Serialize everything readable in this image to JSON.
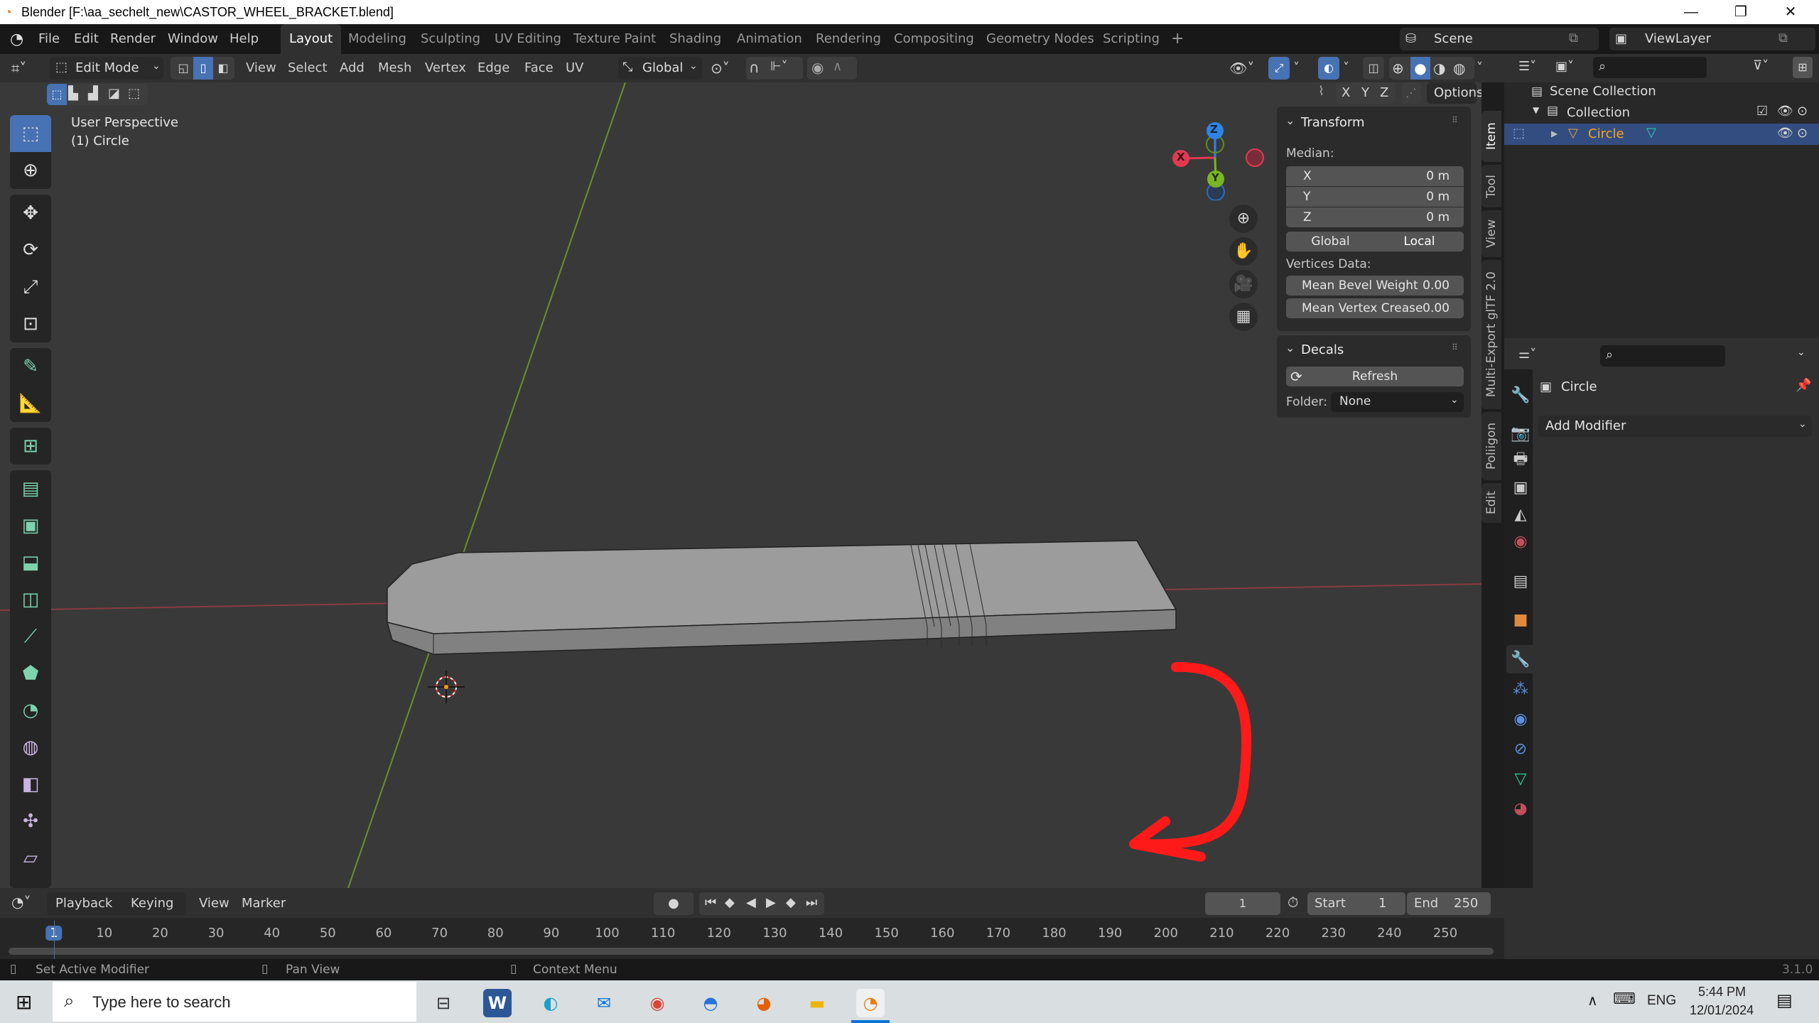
{
  "window": {
    "title": "Blender [F:\\aa_sechelt_new\\CASTOR_WHEEL_BRACKET.blend]",
    "controls": {
      "minimize": "—",
      "restore": "❐",
      "close": "✕"
    }
  },
  "menu": [
    "File",
    "Edit",
    "Render",
    "Window",
    "Help"
  ],
  "workspaces": [
    {
      "label": "Layout",
      "active": true
    },
    {
      "label": "Modeling"
    },
    {
      "label": "Sculpting"
    },
    {
      "label": "UV Editing"
    },
    {
      "label": "Texture Paint"
    },
    {
      "label": "Shading"
    },
    {
      "label": "Animation"
    },
    {
      "label": "Rendering"
    },
    {
      "label": "Compositing"
    },
    {
      "label": "Geometry Nodes"
    },
    {
      "label": "Scripting"
    }
  ],
  "add_workspace": "+",
  "scene": {
    "label": "Scene",
    "view_layer": "ViewLayer"
  },
  "header3d": {
    "mode": "Edit Mode",
    "menus": [
      "View",
      "Select",
      "Add",
      "Mesh",
      "Vertex",
      "Edge",
      "Face",
      "UV"
    ],
    "orientation": "Global",
    "mirror_axes": [
      "X",
      "Y",
      "Z"
    ],
    "options": "Options"
  },
  "viewport": {
    "perspective": "User Perspective",
    "object_label": "(1) Circle",
    "gizmo": {
      "x": "X",
      "y": "Y",
      "z": "Z"
    },
    "annotation_color": "#ff1a1a"
  },
  "transform_panel": {
    "title": "Transform",
    "median_label": "Median:",
    "fields": [
      {
        "axis": "X",
        "value": "0 m"
      },
      {
        "axis": "Y",
        "value": "0 m"
      },
      {
        "axis": "Z",
        "value": "0 m"
      }
    ],
    "space_options": [
      "Global",
      "Local"
    ],
    "active_space": "Local",
    "vertices_label": "Vertices Data:",
    "bevel_weight_label": "Mean Bevel Weight",
    "bevel_weight_value": "0.00",
    "vertex_crease_label": "Mean Vertex Crease",
    "vertex_crease_value": "0.00"
  },
  "decals_panel": {
    "title": "Decals",
    "refresh": "Refresh",
    "folder_label": "Folder:",
    "folder_value": "None"
  },
  "sidebar_tabs": [
    "Item",
    "Tool",
    "View",
    "Multi-Export glTF 2.0",
    "Poliigon",
    "Edit"
  ],
  "outliner": {
    "root": "Scene Collection",
    "collection": "Collection",
    "object": "Circle"
  },
  "properties": {
    "object_name": "Circle",
    "add_modifier": "Add Modifier"
  },
  "timeline": {
    "menus": [
      "Playback",
      "Keying",
      "View",
      "Marker"
    ],
    "current_frame": "1",
    "start_label": "Start",
    "start_value": "1",
    "end_label": "End",
    "end_value": "250",
    "ticks": [
      "1",
      "10",
      "20",
      "30",
      "40",
      "50",
      "60",
      "70",
      "80",
      "90",
      "100",
      "110",
      "120",
      "130",
      "140",
      "150",
      "160",
      "170",
      "180",
      "190",
      "200",
      "210",
      "220",
      "230",
      "240",
      "250"
    ]
  },
  "statusbar": {
    "left": "Set Active Modifier",
    "middle": "Pan View",
    "right": "Context Menu",
    "version": "3.1.0"
  },
  "taskbar": {
    "search_placeholder": "Type here to search",
    "language": "ENG",
    "time": "5:44 PM",
    "date": "12/01/2024"
  }
}
